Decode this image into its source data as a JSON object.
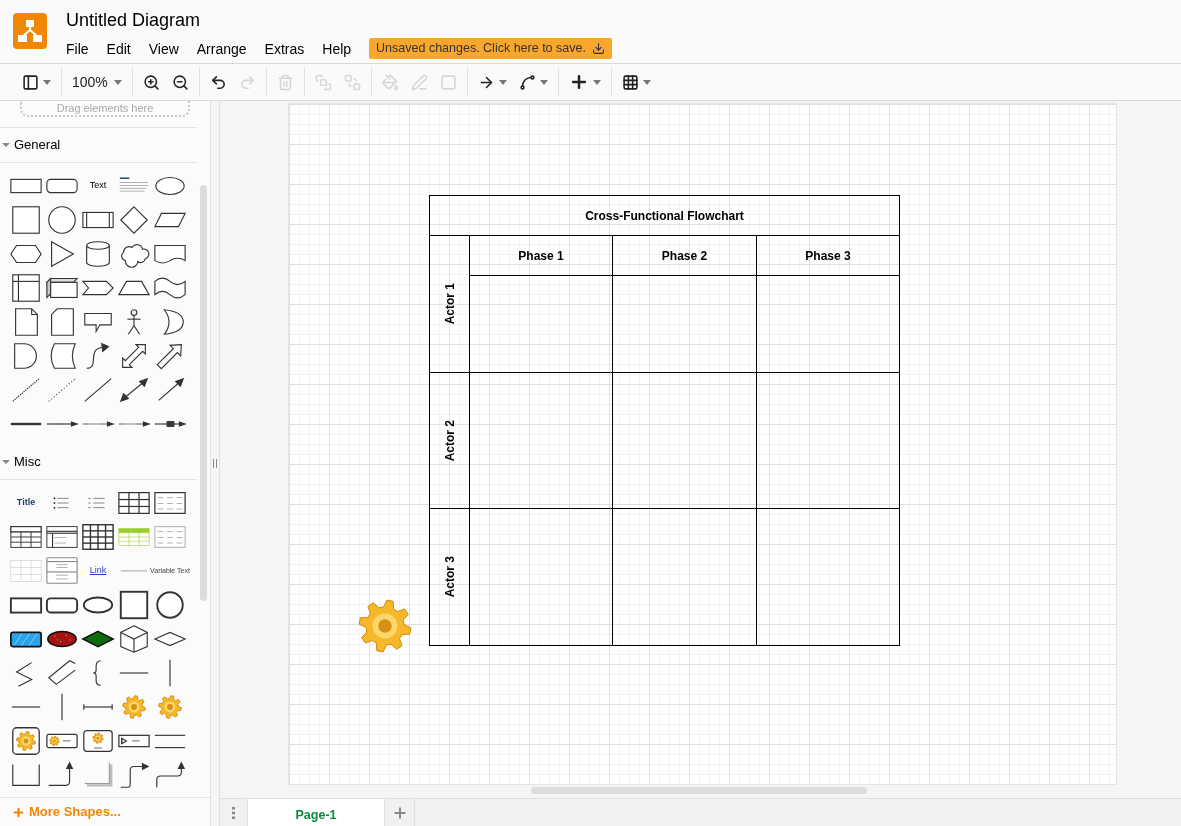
{
  "app": {
    "title": "Untitled Diagram",
    "menu": [
      "File",
      "Edit",
      "View",
      "Arrange",
      "Extras",
      "Help"
    ],
    "save_notice": "Unsaved changes. Click here to save."
  },
  "toolbar": {
    "groups": [
      [
        {
          "kind": "format",
          "disabled": false
        }
      ],
      [
        {
          "kind": "zoom",
          "label": "100%",
          "disabled": false
        }
      ],
      [
        {
          "kind": "zoom-in",
          "disabled": false
        },
        {
          "kind": "zoom-out",
          "disabled": false
        }
      ],
      [
        {
          "kind": "undo",
          "disabled": false
        },
        {
          "kind": "redo",
          "disabled": true
        }
      ],
      [
        {
          "kind": "delete",
          "disabled": true
        }
      ],
      [
        {
          "kind": "to-front",
          "disabled": true
        },
        {
          "kind": "to-back",
          "disabled": true
        }
      ],
      [
        {
          "kind": "fill",
          "disabled": true
        },
        {
          "kind": "line-color",
          "disabled": true
        },
        {
          "kind": "shadow",
          "disabled": true
        }
      ],
      [
        {
          "kind": "connection",
          "disabled": false
        },
        {
          "kind": "waypoints",
          "disabled": false
        }
      ],
      [
        {
          "kind": "insert",
          "disabled": false
        }
      ],
      [
        {
          "kind": "table",
          "disabled": false
        }
      ]
    ]
  },
  "sidebar": {
    "drop_hint": "Drag elements here",
    "sections": [
      {
        "title": "General",
        "expanded": true,
        "shapes": [
          {
            "kind": "rectangle"
          },
          {
            "kind": "rounded-rectangle"
          },
          {
            "kind": "text",
            "text": "Text"
          },
          {
            "kind": "text-block"
          },
          {
            "kind": "ellipse"
          },
          {
            "kind": "square"
          },
          {
            "kind": "circle"
          },
          {
            "kind": "process"
          },
          {
            "kind": "diamond"
          },
          {
            "kind": "parallelogram"
          },
          {
            "kind": "hexagon"
          },
          {
            "kind": "triangle"
          },
          {
            "kind": "cylinder"
          },
          {
            "kind": "cloud"
          },
          {
            "kind": "document"
          },
          {
            "kind": "internal-storage"
          },
          {
            "kind": "cube"
          },
          {
            "kind": "step"
          },
          {
            "kind": "trapezoid"
          },
          {
            "kind": "tape"
          },
          {
            "kind": "note"
          },
          {
            "kind": "card"
          },
          {
            "kind": "callout"
          },
          {
            "kind": "actor"
          },
          {
            "kind": "crescent"
          },
          {
            "kind": "delay"
          },
          {
            "kind": "data-storage"
          },
          {
            "kind": "curved-arrow"
          },
          {
            "kind": "double-arrow"
          },
          {
            "kind": "block-arrow"
          },
          {
            "kind": "dashed-line"
          },
          {
            "kind": "dotted-line"
          },
          {
            "kind": "line"
          },
          {
            "kind": "double-headed-line"
          },
          {
            "kind": "arrow-line"
          },
          {
            "kind": "thick-line"
          },
          {
            "kind": "labeled-connector"
          },
          {
            "kind": "dashed-connector"
          },
          {
            "kind": "dashed-connector"
          },
          {
            "kind": "boxed-connector"
          }
        ]
      },
      {
        "title": "Misc",
        "expanded": true,
        "shapes": [
          {
            "kind": "title",
            "text": "Title"
          },
          {
            "kind": "bullet-list"
          },
          {
            "kind": "numbered-list"
          },
          {
            "kind": "table"
          },
          {
            "kind": "text-table"
          },
          {
            "kind": "header-table"
          },
          {
            "kind": "list-table"
          },
          {
            "kind": "grid-table"
          },
          {
            "kind": "striped-table"
          },
          {
            "kind": "faint-table"
          },
          {
            "kind": "light-table"
          },
          {
            "kind": "container-list"
          },
          {
            "kind": "link",
            "text": "Link"
          },
          {
            "kind": "small-text"
          },
          {
            "kind": "caption",
            "text": "Variable Text"
          },
          {
            "kind": "bold-rectangle"
          },
          {
            "kind": "bold-rounded-rectangle"
          },
          {
            "kind": "bold-ellipse"
          },
          {
            "kind": "bold-square"
          },
          {
            "kind": "bold-circle"
          },
          {
            "kind": "sketch-rectangle"
          },
          {
            "kind": "sketch-ellipse"
          },
          {
            "kind": "sketch-diamond"
          },
          {
            "kind": "isometric-cube"
          },
          {
            "kind": "flat-diamond"
          },
          {
            "kind": "zigzag"
          },
          {
            "kind": "zigzag-alt"
          },
          {
            "kind": "curly-brace"
          },
          {
            "kind": "horizontal-line"
          },
          {
            "kind": "vertical-line"
          },
          {
            "kind": "horizontal-line"
          },
          {
            "kind": "vertical-line"
          },
          {
            "kind": "dimension-line"
          },
          {
            "kind": "gear"
          },
          {
            "kind": "gear"
          },
          {
            "kind": "gear-card"
          },
          {
            "kind": "gear-label"
          },
          {
            "kind": "gear-box"
          },
          {
            "kind": "play-label"
          },
          {
            "kind": "double-line"
          },
          {
            "kind": "bracket"
          },
          {
            "kind": "elbow-arrow"
          },
          {
            "kind": "shadow-corner"
          },
          {
            "kind": "s-arrow"
          },
          {
            "kind": "step-arrow"
          }
        ]
      }
    ],
    "more_shapes": "More Shapes..."
  },
  "diagram": {
    "title": "Cross-Functional Flowchart",
    "phases": [
      "Phase 1",
      "Phase 2",
      "Phase 3"
    ],
    "actors": [
      "Actor 1",
      "Actor 2",
      "Actor 3"
    ],
    "gear": {
      "kind": "gear"
    }
  },
  "pages": [
    {
      "label": "Page-1",
      "selected": true
    }
  ]
}
